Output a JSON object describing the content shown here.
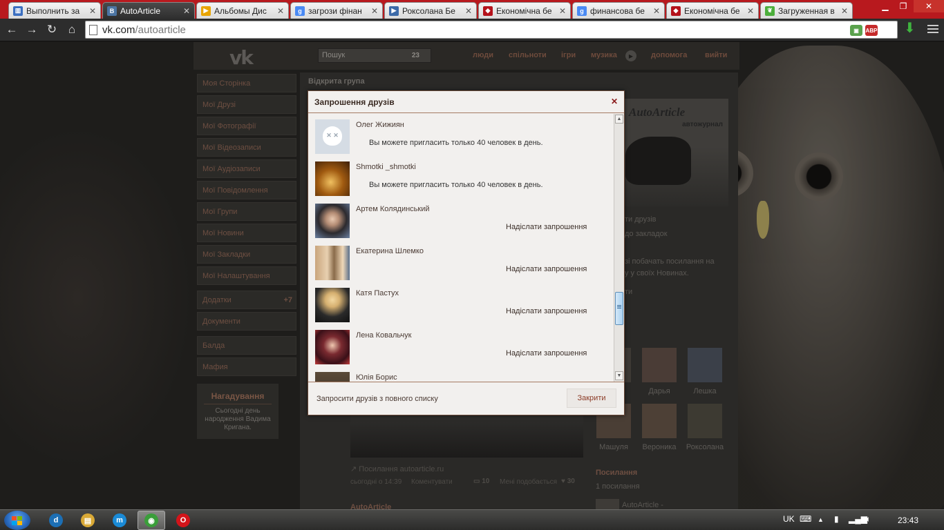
{
  "browser": {
    "tabs": [
      {
        "title": "Выполнить за",
        "icon": "chart-icon",
        "color": "#3b6fc1",
        "glyph": "▥"
      },
      {
        "title": "AutoArticle",
        "icon": "vk-icon",
        "color": "#4c75a3",
        "glyph": "B",
        "active": true
      },
      {
        "title": "Альбомы Дис",
        "icon": "play-icon",
        "color": "#e8a400",
        "glyph": "▶"
      },
      {
        "title": "загрози фінан",
        "icon": "google-icon",
        "color": "#4a8af4",
        "glyph": "g"
      },
      {
        "title": "Роксолана Бе",
        "icon": "video-icon",
        "color": "#3c6aa8",
        "glyph": "▶"
      },
      {
        "title": "Економічна бе",
        "icon": "site-icon",
        "color": "#b5121b",
        "glyph": "◆"
      },
      {
        "title": "финансова бе",
        "icon": "google-icon",
        "color": "#4a8af4",
        "glyph": "g"
      },
      {
        "title": "Економічна бе",
        "icon": "site-icon",
        "color": "#b5121b",
        "glyph": "◆"
      },
      {
        "title": "Загруженная в",
        "icon": "leaf-icon",
        "color": "#4cae3b",
        "glyph": "❦"
      }
    ],
    "url_host": "vk.com",
    "url_path": "/autoarticle",
    "extensions": [
      {
        "name": "extension-image-icon",
        "color": "#5aa24c",
        "glyph": "▣"
      },
      {
        "name": "adblock-icon",
        "color": "#c52a2a",
        "glyph": "ABP"
      }
    ]
  },
  "vk": {
    "logo": "vk",
    "search_placeholder": "Пошук",
    "search_count": "23",
    "nav": [
      "люди",
      "спільноти",
      "ігри",
      "музика",
      "допомога",
      "вийти"
    ],
    "menu": [
      "Моя Сторінка",
      "Мої Друзі",
      "Мої Фотографії",
      "Мої Відеозаписи",
      "Мої Аудіозаписи",
      "Мої Повідомлення",
      "Мої Групи",
      "Мої Новини",
      "Мої Закладки",
      "Мої Налаштування"
    ],
    "menu2": [
      {
        "label": "Додатки",
        "badge": "+7"
      },
      {
        "label": "Документи",
        "badge": ""
      }
    ],
    "menu3": [
      "Балда",
      "Мафия"
    ],
    "reminder_title": "Нагадування",
    "reminder_text": "Сьогодні день народження Вадима Кригана.",
    "group_kind": "Відкрита група",
    "cover_title": "AutoArticle",
    "cover_sub": "автожурнал",
    "side_lines": [
      "ти друзів",
      "до закладок",
      "зі побачать посилання на",
      "у у своїх Новинах.",
      "ти"
    ],
    "friends_row1": [
      "",
      "Дарья",
      "Лешка"
    ],
    "friends_row2": [
      "Машуля",
      "Вероника",
      "Роксолана"
    ],
    "links_head": "Посилання",
    "links_sub": "1 посилання",
    "links_item": "AutoArticle -",
    "post_link": "Посилання autoarticle.ru",
    "post_date": "сьогодні о 14:39",
    "post_comment": "Коментувати",
    "post_shares": "10",
    "post_likes_label": "Мені подобається",
    "post_likes": "30",
    "post_author": "AutoArticle"
  },
  "modal": {
    "title": "Запрошення друзів",
    "rows": [
      {
        "name": "Олег Жижиян",
        "note": "Вы можете пригласить только 40 человек в день.",
        "action": "",
        "avatar": "deactivated"
      },
      {
        "name": "Shmotki _shmotki",
        "note": "Вы можете пригласить только 40 человек в день.",
        "action": "",
        "avatar": "warm"
      },
      {
        "name": "Артем Колядинський",
        "note": "",
        "action": "Надіслати запрошення",
        "avatar": "man"
      },
      {
        "name": "Екатерина Шлемко",
        "note": "",
        "action": "Надіслати запрошення",
        "avatar": "pair"
      },
      {
        "name": "Катя Пастух",
        "note": "",
        "action": "Надіслати запрошення",
        "avatar": "blonde"
      },
      {
        "name": "Лена Ковальчук",
        "note": "",
        "action": "Надіслати запрошення",
        "avatar": "curly"
      },
      {
        "name": "Юлія Борис",
        "note": "",
        "action": "Надіслати запрошення",
        "avatar": "partial"
      }
    ],
    "footer_link": "Запросити друзів з повного списку",
    "close_label": "Закрити"
  },
  "taskbar": {
    "lang": "UK",
    "time": "23:43",
    "apps": [
      {
        "name": "daemon-tools-icon",
        "color": "#1c6fb5",
        "glyph": "d"
      },
      {
        "name": "explorer-icon",
        "color": "#d9a936",
        "glyph": "▤"
      },
      {
        "name": "maxthon-icon",
        "color": "#1a8ad6",
        "glyph": "m"
      },
      {
        "name": "chrome-icon",
        "color": "#3a9e3a",
        "glyph": "◉",
        "active": true
      },
      {
        "name": "opera-icon",
        "color": "#d3141a",
        "glyph": "O"
      }
    ]
  }
}
